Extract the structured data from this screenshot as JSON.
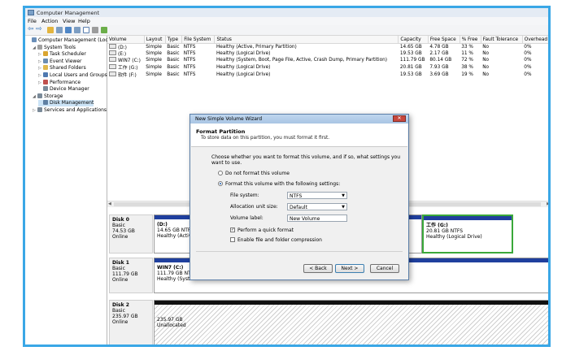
{
  "window": {
    "title": "Computer Management"
  },
  "menu": [
    "File",
    "Action",
    "View",
    "Help"
  ],
  "tree": {
    "items": [
      {
        "label": "Computer Management (Local",
        "indent": 0,
        "arrow": "",
        "color": "#6b8fb8"
      },
      {
        "label": "System Tools",
        "indent": 1,
        "arrow": "◢",
        "color": "#a0a0a0"
      },
      {
        "label": "Task Scheduler",
        "indent": 2,
        "arrow": "▷",
        "color": "#d9a531"
      },
      {
        "label": "Event Viewer",
        "indent": 2,
        "arrow": "▷",
        "color": "#6a8db3"
      },
      {
        "label": "Shared Folders",
        "indent": 2,
        "arrow": "▷",
        "color": "#e0b84c"
      },
      {
        "label": "Local Users and Groups",
        "indent": 2,
        "arrow": "▷",
        "color": "#4f79b0"
      },
      {
        "label": "Performance",
        "indent": 2,
        "arrow": "▷",
        "color": "#c0504d"
      },
      {
        "label": "Device Manager",
        "indent": 2,
        "arrow": "",
        "color": "#7a8a99"
      },
      {
        "label": "Storage",
        "indent": 1,
        "arrow": "◢",
        "color": "#7a8a99"
      },
      {
        "label": "Disk Management",
        "indent": 2,
        "arrow": "",
        "color": "#5e7fa3"
      },
      {
        "label": "Services and Applications",
        "indent": 1,
        "arrow": "▷",
        "color": "#7a8a99"
      }
    ]
  },
  "table": {
    "headers": [
      "Volume",
      "Layout",
      "Type",
      "File System",
      "Status",
      "Capacity",
      "Free Space",
      "% Free",
      "Fault Tolerance",
      "Overhead"
    ],
    "rows": [
      [
        "(D:)",
        "Simple",
        "Basic",
        "NTFS",
        "Healthy (Active, Primary Partition)",
        "14.65 GB",
        "4.78 GB",
        "33 %",
        "No",
        "0%"
      ],
      [
        "(E:)",
        "Simple",
        "Basic",
        "NTFS",
        "Healthy (Logical Drive)",
        "19.53 GB",
        "2.17 GB",
        "11 %",
        "No",
        "0%"
      ],
      [
        "WIN7 (C:)",
        "Simple",
        "Basic",
        "NTFS",
        "Healthy (System, Boot, Page File, Active, Crash Dump, Primary Partition)",
        "111.79 GB",
        "80.14 GB",
        "72 %",
        "No",
        "0%"
      ],
      [
        "工作 (G:)",
        "Simple",
        "Basic",
        "NTFS",
        "Healthy (Logical Drive)",
        "20.81 GB",
        "7.93 GB",
        "38 %",
        "No",
        "0%"
      ],
      [
        "软件 (F:)",
        "Simple",
        "Basic",
        "NTFS",
        "Healthy (Logical Drive)",
        "19.53 GB",
        "3.69 GB",
        "19 %",
        "No",
        "0%"
      ]
    ]
  },
  "disks": [
    {
      "name": "Disk 0",
      "type": "Basic",
      "size": "74.53 GB",
      "state": "Online",
      "p1_name": "(D:)",
      "p1_size": "14.65 GB NTFS",
      "p1_status": "Healthy (Active",
      "p2_name": "工作 (G:)",
      "p2_size": "20.81 GB NTFS",
      "p2_status": "Healthy (Logical Drive)"
    },
    {
      "name": "Disk 1",
      "type": "Basic",
      "size": "111.79 GB",
      "state": "Online",
      "p1_name": "WIN7 (C:)",
      "p1_size": "111.79 GB NTFS",
      "p1_status": "Healthy (Syster"
    },
    {
      "name": "Disk 2",
      "type": "Basic",
      "size": "235.97 GB",
      "state": "Online",
      "p1_size": "235.97 GB",
      "p1_status": "Unallocated"
    }
  ],
  "wizard": {
    "title": "New Simple Volume Wizard",
    "close": "✕",
    "heading": "Format Partition",
    "subheading": "To store data on this partition, you must format it first.",
    "prompt": "Choose whether you want to format this volume, and if so, what settings you want to use.",
    "opt_no_format": "Do not format this volume",
    "opt_format": "Format this volume with the following settings:",
    "fs_label": "File system:",
    "fs_value": "NTFS",
    "alloc_label": "Allocation unit size:",
    "alloc_value": "Default",
    "vol_label": "Volume label:",
    "vol_value": "New Volume",
    "quick_format": "Perform a quick format",
    "compression": "Enable file and folder compression",
    "back": "< Back",
    "next": "Next >",
    "cancel": "Cancel"
  },
  "colors": {
    "primary_bar": "#1f3f9e",
    "logical_border": "#3aa83a",
    "unallocated_bar": "#111111",
    "frame": "#3aa7e6"
  }
}
